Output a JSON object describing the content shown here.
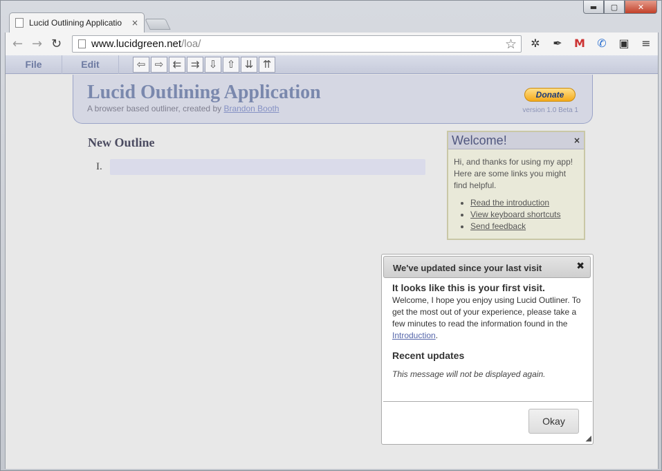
{
  "browser": {
    "tab_title": "Lucid Outlining Applicatio",
    "tab_close": "×",
    "url_host": "www.lucidgreen.net",
    "url_path": "/loa/",
    "window_controls": {
      "minimize": "▬",
      "maximize": "▢",
      "close": "✕"
    }
  },
  "menu": {
    "file": "File",
    "edit": "Edit"
  },
  "tools": [
    "⇦",
    "⇨",
    "⇇",
    "⇉",
    "⇩",
    "⇧",
    "⇊",
    "⇈"
  ],
  "header": {
    "title": "Lucid Outlining Application",
    "subtitle_prefix": "A browser based outliner, created by ",
    "author_link": "Brandon Booth",
    "donate": "Donate",
    "version": "version 1.0 Beta 1"
  },
  "outline": {
    "title": "New Outline",
    "item_number": "I."
  },
  "welcome": {
    "title": "Welcome!",
    "close": "×",
    "text": "Hi, and thanks for using my app! Here are some links you might find helpful.",
    "links": [
      "Read the introduction",
      "View keyboard shortcuts",
      "Send feedback"
    ]
  },
  "dialog": {
    "title": "We've updated since your last visit",
    "close": "✖",
    "heading": "It looks like this is your first visit.",
    "text_before_link": "Welcome, I hope you enjoy using Lucid Outliner. To get the most out of your experience, please take a few minutes to read the information found in the ",
    "link": "Introduction",
    "text_after_link": ".",
    "recent_heading": "Recent updates",
    "note": "This message will not be displayed again.",
    "button": "Okay"
  }
}
